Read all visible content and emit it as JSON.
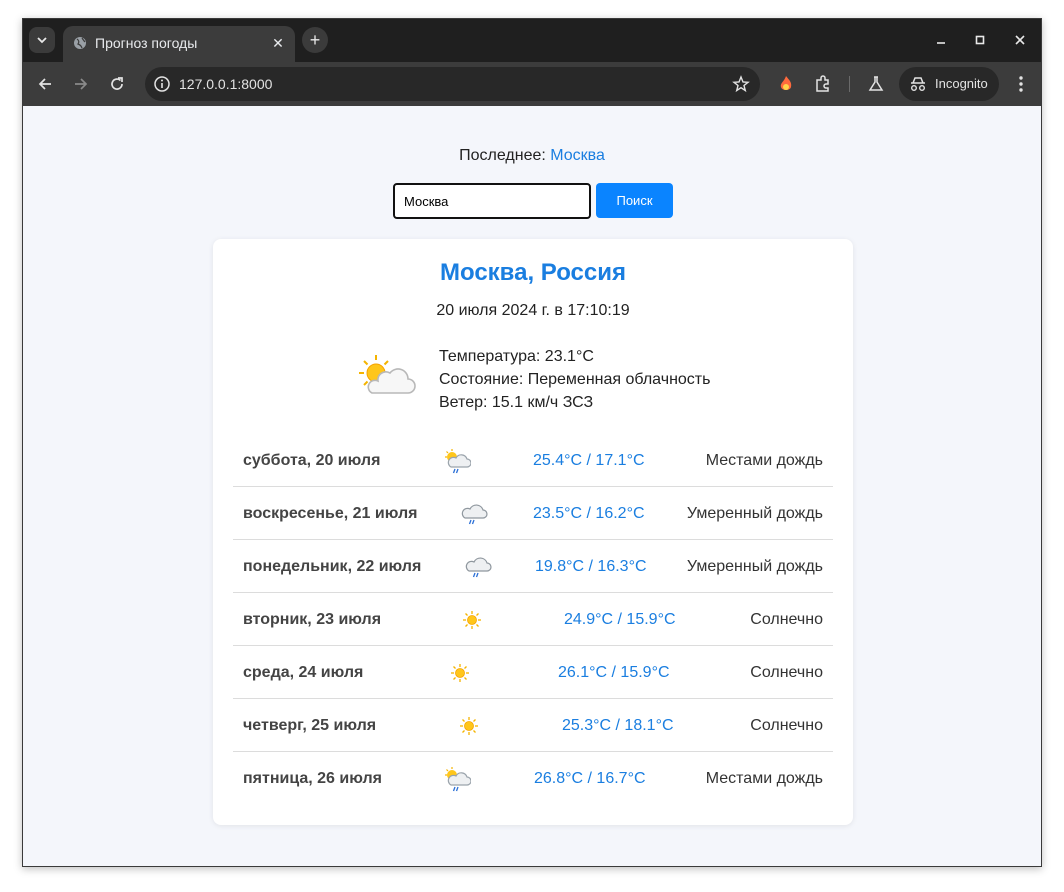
{
  "browser": {
    "tab_title": "Прогноз погоды",
    "url": "127.0.0.1:8000",
    "incognito_label": "Incognito"
  },
  "recent": {
    "label": "Последнее:",
    "city": "Москва"
  },
  "search": {
    "value": "Москва",
    "button_label": "Поиск"
  },
  "current": {
    "title": "Москва, Россия",
    "datetime": "20 июля 2024 г. в 17:10:19",
    "icon": "partly-cloudy-icon",
    "temperature": "Температура: 23.1°C",
    "condition": "Состояние: Переменная облачность",
    "wind": "Ветер: 15.1 км/ч ЗСЗ"
  },
  "forecast": [
    {
      "day": "суббота, 20 июля",
      "icon": "sun-cloud-rain-icon",
      "temps": "25.4°C / 17.1°C",
      "condition": "Местами дождь"
    },
    {
      "day": "воскресенье, 21 июля",
      "icon": "cloud-rain-icon",
      "temps": "23.5°C / 16.2°C",
      "condition": "Умеренный дождь"
    },
    {
      "day": "понедельник, 22 июля",
      "icon": "cloud-rain-icon",
      "temps": "19.8°C / 16.3°C",
      "condition": "Умеренный дождь"
    },
    {
      "day": "вторник, 23 июля",
      "icon": "sun-icon",
      "temps": "24.9°C / 15.9°C",
      "condition": "Солнечно"
    },
    {
      "day": "среда, 24 июля",
      "icon": "sun-icon",
      "temps": "26.1°C / 15.9°C",
      "condition": "Солнечно"
    },
    {
      "day": "четверг, 25 июля",
      "icon": "sun-icon",
      "temps": "25.3°C / 18.1°C",
      "condition": "Солнечно"
    },
    {
      "day": "пятница, 26 июля",
      "icon": "sun-cloud-rain-icon",
      "temps": "26.8°C / 16.7°C",
      "condition": "Местами дождь"
    }
  ],
  "colors": {
    "accent": "#1a7ee0",
    "button": "#0a84ff",
    "background": "#f4f6fb"
  }
}
